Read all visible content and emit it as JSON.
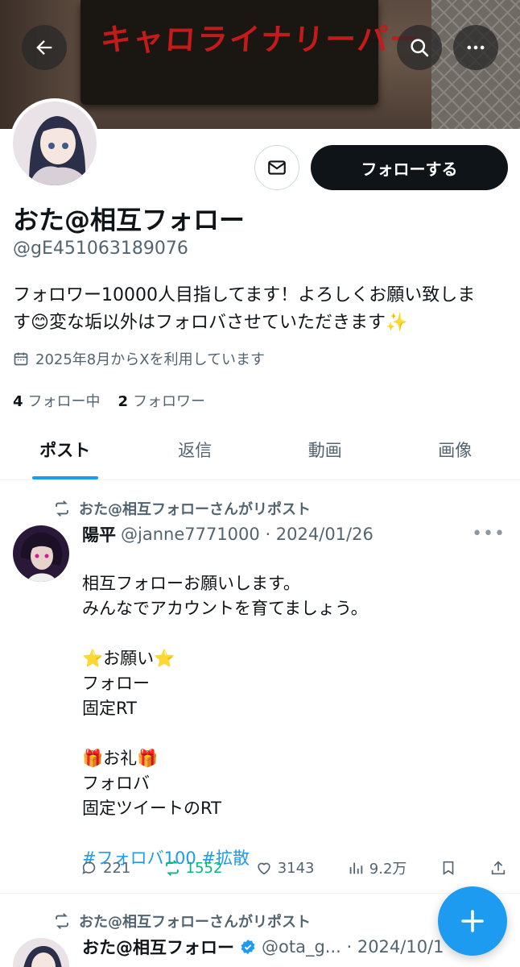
{
  "banner": {
    "sign_text": "キャロライナリーパー"
  },
  "profile": {
    "display_name": "おた@相互フォロー",
    "handle": "@gE451063189076",
    "bio_line1": "フォロワー10000人目指してます！よろしくお願い致しま",
    "bio_line2_a": "す",
    "bio_emoji1": "😊",
    "bio_line2_b": "変な垢以外はフォロバさせていただきます",
    "bio_emoji2": "✨",
    "joined": "2025年8月からXを利用しています",
    "following_count": "4",
    "following_label": "フォロー中",
    "followers_count": "2",
    "followers_label": "フォロワー"
  },
  "buttons": {
    "follow": "フォローする"
  },
  "tabs": [
    {
      "label": "ポスト",
      "active": true
    },
    {
      "label": "返信"
    },
    {
      "label": "動画"
    },
    {
      "label": "画像"
    }
  ],
  "posts": [
    {
      "repost_label": "おた@相互フォローさんがリポスト",
      "name": "陽平",
      "handle_date": "@janne7771000 · 2024/01/26",
      "body_lines": "相互フォローお願いします。\nみんなでアカウントを育てましょう。\n\n⭐お願い⭐\nフォロー\n固定RT\n\n🎁お礼🎁\nフォロバ\n固定ツイートのRT\n",
      "hashtags": "#フォロバ100 #拡散",
      "replies": "221",
      "reposts": "1552",
      "likes": "3143",
      "views": "9.2万"
    },
    {
      "repost_label": "おた@相互フォローさんがリポスト",
      "name": "おた@相互フォロー",
      "handle_date": "@ota_g... · 2024/10/1"
    }
  ],
  "colors": {
    "accent": "#1d9bf0",
    "repost_green": "#00ba7c",
    "text": "#0f1419",
    "muted": "#536471"
  }
}
